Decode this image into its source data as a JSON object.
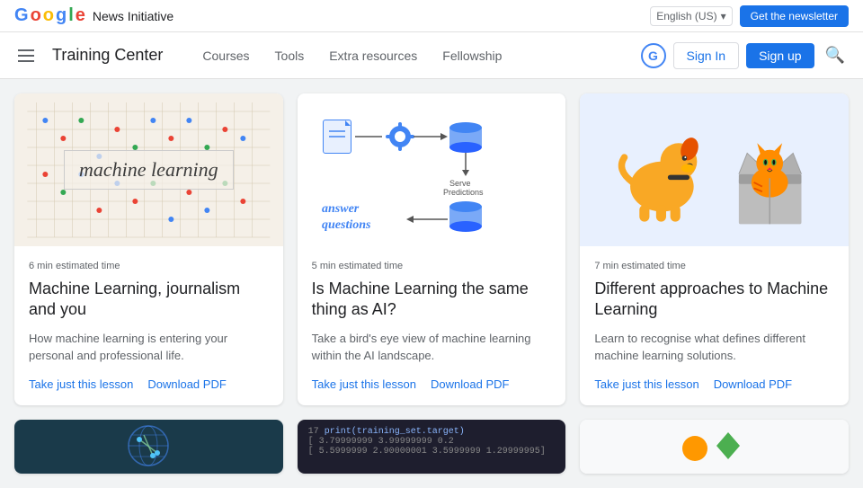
{
  "topbar": {
    "brand": "Google",
    "brand_parts": [
      "G",
      "o",
      "o",
      "g",
      "l",
      "e"
    ],
    "title": "News Initiative",
    "lang_label": "English (US)",
    "newsletter_btn": "Get the newsletter"
  },
  "navbar": {
    "brand": "Training Center",
    "links": [
      "Courses",
      "Tools",
      "Extra resources",
      "Fellowship"
    ],
    "sign_in": "Sign In",
    "sign_up": "Sign up"
  },
  "cards": [
    {
      "time": "6 min estimated time",
      "title": "Machine Learning, journalism and you",
      "desc": "How machine learning is entering your personal and professional life.",
      "link1": "Take just this lesson",
      "link2": "Download PDF",
      "image_type": "ml_grid"
    },
    {
      "time": "5 min estimated time",
      "title": "Is Machine Learning the same thing as AI?",
      "desc": "Take a bird's eye view of machine learning within the AI landscape.",
      "link1": "Take just this lesson",
      "link2": "Download PDF",
      "image_type": "diagram"
    },
    {
      "time": "7 min estimated time",
      "title": "Different approaches to Machine Learning",
      "desc": "Learn to recognise what defines different machine learning solutions.",
      "link1": "Take just this lesson",
      "link2": "Download PDF",
      "image_type": "animals"
    }
  ],
  "bottom_cards": [
    {
      "type": "globe"
    },
    {
      "type": "code"
    },
    {
      "type": "shapes"
    }
  ]
}
